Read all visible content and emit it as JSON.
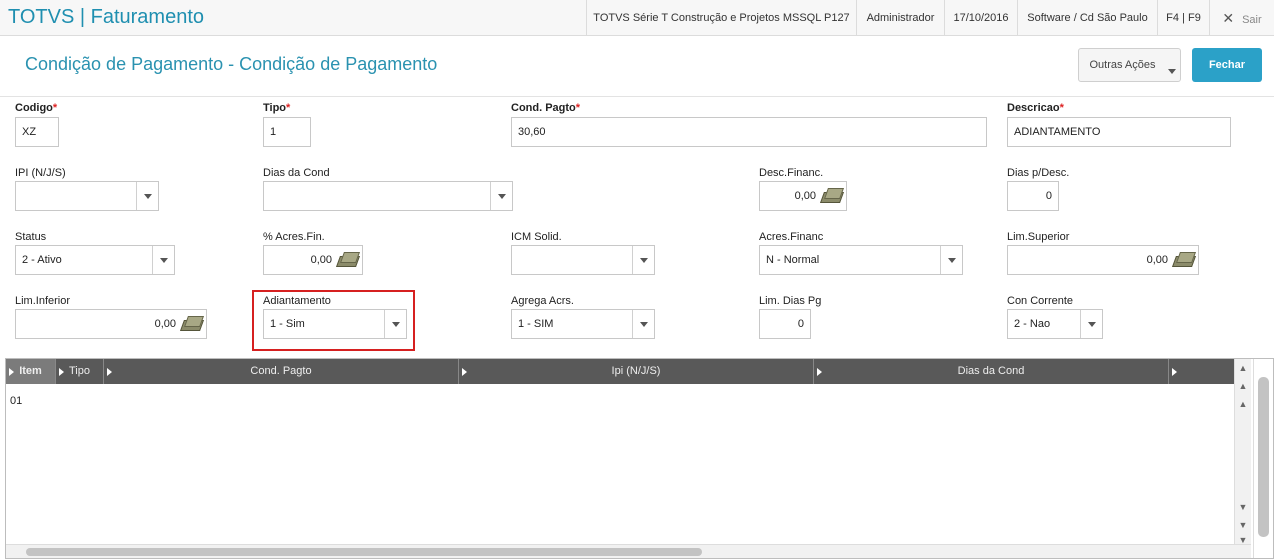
{
  "header": {
    "app_title": "TOTVS | Faturamento",
    "environment": "TOTVS Série T Construção e Projetos MSSQL P127",
    "user": "Administrador",
    "date": "17/10/2016",
    "company": "Software / Cd São Paulo",
    "shortcuts": "F4 | F9",
    "exit_label": "Sair",
    "exit_icon": "✕"
  },
  "title_bar": {
    "title": "Condição de Pagamento - Condição de Pagamento",
    "other_actions_label": "Outras Ações",
    "close_label": "Fechar"
  },
  "form": {
    "codigo": {
      "label": "Codigo",
      "required": "*",
      "value": "XZ"
    },
    "tipo": {
      "label": "Tipo",
      "required": "*",
      "value": "1"
    },
    "cond_pagto": {
      "label": "Cond. Pagto",
      "required": "*",
      "value": "30,60"
    },
    "descricao": {
      "label": "Descricao",
      "required": "*",
      "value": "ADIANTAMENTO"
    },
    "ipi": {
      "label": "IPI (N/J/S)",
      "value": ""
    },
    "dias_da_cond": {
      "label": "Dias da Cond",
      "value": ""
    },
    "desc_financ": {
      "label": "Desc.Financ.",
      "value": "0,00"
    },
    "dias_p_desc": {
      "label": "Dias p/Desc.",
      "value": "0"
    },
    "status": {
      "label": "Status",
      "value": "2 - Ativo"
    },
    "acres_fin": {
      "label": "% Acres.Fin.",
      "value": "0,00"
    },
    "icm_solid": {
      "label": "ICM Solid.",
      "value": ""
    },
    "acres_financ": {
      "label": "Acres.Financ",
      "value": "N - Normal"
    },
    "lim_superior": {
      "label": "Lim.Superior",
      "value": "0,00"
    },
    "lim_inferior": {
      "label": "Lim.Inferior",
      "value": "0,00"
    },
    "adiantamento": {
      "label": "Adiantamento",
      "value": "1 - Sim"
    },
    "agrega_acrs": {
      "label": "Agrega Acrs.",
      "value": "1 - SIM"
    },
    "lim_dias_pg": {
      "label": "Lim. Dias Pg",
      "value": "0"
    },
    "con_corrente": {
      "label": "Con Corrente",
      "value": "2 - Nao"
    }
  },
  "grid": {
    "columns": [
      "Item",
      "Tipo",
      "Cond. Pagto",
      "Ipi (N/J/S)",
      "Dias da Cond"
    ],
    "rows": [
      {
        "item": "01"
      }
    ]
  },
  "colors": {
    "accent": "#2ba1c8",
    "title": "#2a92b0",
    "highlight": "#d62020",
    "grid_header": "#595959"
  }
}
